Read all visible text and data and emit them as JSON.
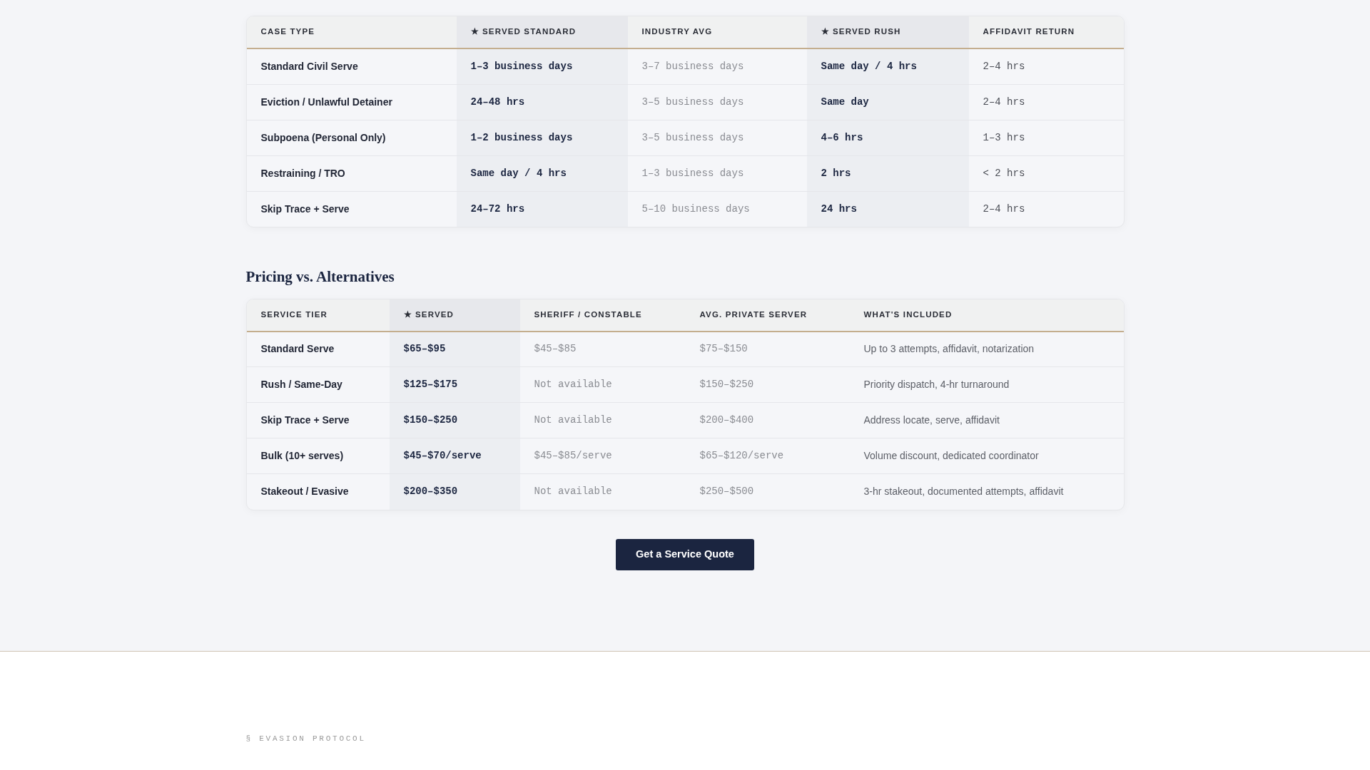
{
  "turnaround_table": {
    "columns": [
      {
        "label": "CASE TYPE",
        "kind": "label"
      },
      {
        "label": "★ SERVED STANDARD",
        "kind": "featured"
      },
      {
        "label": "INDUSTRY AVG",
        "kind": "muted"
      },
      {
        "label": "★ SERVED RUSH",
        "kind": "featured"
      },
      {
        "label": "AFFIDAVIT RETURN",
        "kind": "plain"
      }
    ],
    "rows": [
      [
        "Standard Civil Serve",
        "1–3 business days",
        "3–7 business days",
        "Same day / 4 hrs",
        "2–4 hrs"
      ],
      [
        "Eviction / Unlawful Detainer",
        "24–48 hrs",
        "3–5 business days",
        "Same day",
        "2–4 hrs"
      ],
      [
        "Subpoena (Personal Only)",
        "1–2 business days",
        "3–5 business days",
        "4–6 hrs",
        "1–3 hrs"
      ],
      [
        "Restraining / TRO",
        "Same day / 4 hrs",
        "1–3 business days",
        "2 hrs",
        "< 2 hrs"
      ],
      [
        "Skip Trace + Serve",
        "24–72 hrs",
        "5–10 business days",
        "24 hrs",
        "2–4 hrs"
      ]
    ]
  },
  "pricing": {
    "title": "Pricing vs. Alternatives",
    "columns": [
      {
        "label": "SERVICE TIER",
        "kind": "label"
      },
      {
        "label": "★ SERVED",
        "kind": "featured"
      },
      {
        "label": "SHERIFF / CONSTABLE",
        "kind": "muted"
      },
      {
        "label": "AVG. PRIVATE SERVER",
        "kind": "muted"
      },
      {
        "label": "WHAT'S INCLUDED",
        "kind": "text"
      }
    ],
    "rows": [
      [
        "Standard Serve",
        "$65–$95",
        "$45–$85",
        "$75–$150",
        "Up to 3 attempts, affidavit, notarization"
      ],
      [
        "Rush / Same-Day",
        "$125–$175",
        "Not available",
        "$150–$250",
        "Priority dispatch, 4-hr turnaround"
      ],
      [
        "Skip Trace + Serve",
        "$150–$250",
        "Not available",
        "$200–$400",
        "Address locate, serve, affidavit"
      ],
      [
        "Bulk (10+ serves)",
        "$45–$70/serve",
        "$45–$85/serve",
        "$65–$120/serve",
        "Volume discount, dedicated coordinator"
      ],
      [
        "Stakeout / Evasive",
        "$200–$350",
        "Not available",
        "$250–$500",
        "3-hr stakeout, documented attempts, affidavit"
      ]
    ]
  },
  "quote_button": "Get a Service Quote",
  "evasion": {
    "eyebrow": "§ EVASION PROTOCOL"
  }
}
